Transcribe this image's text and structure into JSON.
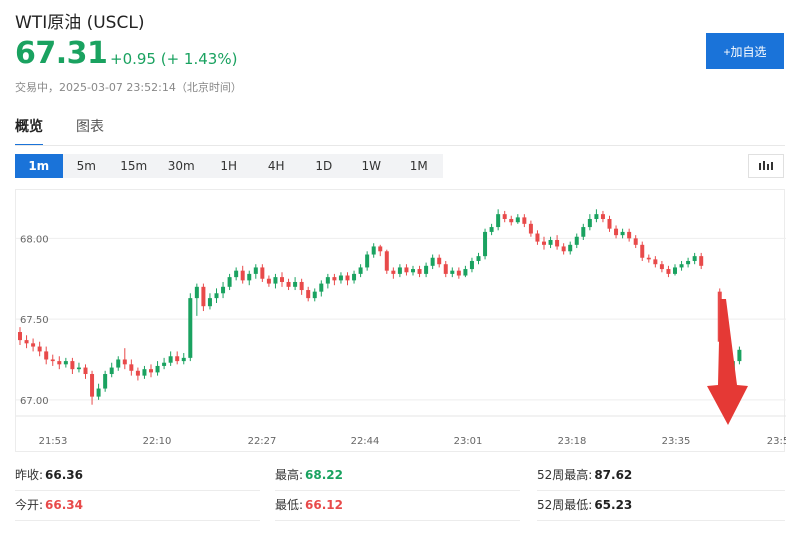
{
  "header": {
    "title": "WTI原油 (USCL)",
    "price": "67.31",
    "change": "+0.95 (+ 1.43%)",
    "status": "交易中，2025-03-07 23:52:14（北京时间）",
    "add_label": "+加自选"
  },
  "tabs": [
    {
      "label": "概览",
      "active": true
    },
    {
      "label": "图表",
      "active": false
    }
  ],
  "periods": [
    {
      "label": "1m",
      "active": true
    },
    {
      "label": "5m"
    },
    {
      "label": "15m"
    },
    {
      "label": "30m"
    },
    {
      "label": "1H"
    },
    {
      "label": "4H"
    },
    {
      "label": "1D"
    },
    {
      "label": "1W"
    },
    {
      "label": "1M"
    }
  ],
  "stats": {
    "prev_close_label": "昨收:",
    "prev_close": "66.36",
    "high_label": "最高:",
    "high": "68.22",
    "w52_high_label": "52周最高:",
    "w52_high": "87.62",
    "open_label": "今开:",
    "open": "66.34",
    "low_label": "最低:",
    "low": "66.12",
    "w52_low_label": "52周最低:",
    "w52_low": "65.23"
  },
  "colors": {
    "up": "#1aa260",
    "down": "#e84a4a",
    "accent": "#1a73d9",
    "annotation_arrow": "#e53935"
  },
  "chart_data": {
    "type": "candlestick",
    "x_ticks": [
      "21:53",
      "22:10",
      "22:27",
      "22:44",
      "23:01",
      "23:18",
      "23:35",
      "23:5"
    ],
    "y_ticks": [
      "68.00",
      "67.50",
      "67.00"
    ],
    "ylim": [
      66.9,
      68.25
    ],
    "grid": "horizontal",
    "annotation": "red-down-arrow",
    "candles": [
      [
        67.42,
        67.37,
        67.45,
        67.34
      ],
      [
        67.37,
        67.35,
        67.4,
        67.32
      ],
      [
        67.35,
        67.33,
        67.38,
        67.3
      ],
      [
        67.33,
        67.3,
        67.36,
        67.27
      ],
      [
        67.3,
        67.25,
        67.33,
        67.22
      ],
      [
        67.25,
        67.24,
        67.28,
        67.21
      ],
      [
        67.24,
        67.22,
        67.27,
        67.19
      ],
      [
        67.22,
        67.24,
        67.26,
        67.2
      ],
      [
        67.24,
        67.19,
        67.26,
        67.16
      ],
      [
        67.19,
        67.2,
        67.23,
        67.17
      ],
      [
        67.2,
        67.16,
        67.22,
        67.13
      ],
      [
        67.16,
        67.02,
        67.18,
        66.97
      ],
      [
        67.02,
        67.07,
        67.1,
        67.0
      ],
      [
        67.07,
        67.16,
        67.18,
        67.05
      ],
      [
        67.16,
        67.2,
        67.23,
        67.14
      ],
      [
        67.2,
        67.25,
        67.27,
        67.18
      ],
      [
        67.25,
        67.22,
        67.32,
        67.19
      ],
      [
        67.22,
        67.18,
        67.25,
        67.15
      ],
      [
        67.18,
        67.15,
        67.2,
        67.12
      ],
      [
        67.15,
        67.19,
        67.21,
        67.13
      ],
      [
        67.19,
        67.17,
        67.22,
        67.14
      ],
      [
        67.17,
        67.21,
        67.24,
        67.15
      ],
      [
        67.21,
        67.23,
        67.26,
        67.19
      ],
      [
        67.23,
        67.27,
        67.3,
        67.21
      ],
      [
        67.27,
        67.24,
        67.3,
        67.22
      ],
      [
        67.24,
        67.26,
        67.29,
        67.22
      ],
      [
        67.26,
        67.63,
        67.66,
        67.24
      ],
      [
        67.63,
        67.7,
        67.72,
        67.52
      ],
      [
        67.7,
        67.58,
        67.72,
        67.55
      ],
      [
        67.58,
        67.63,
        67.66,
        67.56
      ],
      [
        67.63,
        67.66,
        67.69,
        67.6
      ],
      [
        67.66,
        67.7,
        67.73,
        67.63
      ],
      [
        67.7,
        67.76,
        67.78,
        67.68
      ],
      [
        67.76,
        67.8,
        67.82,
        67.74
      ],
      [
        67.8,
        67.74,
        67.83,
        67.72
      ],
      [
        67.74,
        67.78,
        67.8,
        67.71
      ],
      [
        67.78,
        67.82,
        67.84,
        67.75
      ],
      [
        67.82,
        67.75,
        67.84,
        67.73
      ],
      [
        67.75,
        67.72,
        67.77,
        67.7
      ],
      [
        67.72,
        67.76,
        67.78,
        67.69
      ],
      [
        67.76,
        67.73,
        67.79,
        67.7
      ],
      [
        67.73,
        67.7,
        67.75,
        67.68
      ],
      [
        67.7,
        67.73,
        67.76,
        67.68
      ],
      [
        67.73,
        67.68,
        67.75,
        67.65
      ],
      [
        67.68,
        67.63,
        67.7,
        67.61
      ],
      [
        67.63,
        67.67,
        67.69,
        67.61
      ],
      [
        67.67,
        67.72,
        67.74,
        67.64
      ],
      [
        67.72,
        67.76,
        67.78,
        67.69
      ],
      [
        67.76,
        67.74,
        67.78,
        67.71
      ],
      [
        67.74,
        67.77,
        67.79,
        67.72
      ],
      [
        67.77,
        67.74,
        67.79,
        67.71
      ],
      [
        67.74,
        67.78,
        67.8,
        67.72
      ],
      [
        67.78,
        67.82,
        67.84,
        67.76
      ],
      [
        67.82,
        67.9,
        67.92,
        67.8
      ],
      [
        67.9,
        67.95,
        67.97,
        67.88
      ],
      [
        67.95,
        67.92,
        67.96,
        67.89
      ],
      [
        67.92,
        67.8,
        67.93,
        67.78
      ],
      [
        67.8,
        67.78,
        67.82,
        67.75
      ],
      [
        67.78,
        67.82,
        67.84,
        67.76
      ],
      [
        67.82,
        67.79,
        67.84,
        67.77
      ],
      [
        67.79,
        67.81,
        67.83,
        67.77
      ],
      [
        67.81,
        67.78,
        67.83,
        67.76
      ],
      [
        67.78,
        67.83,
        67.85,
        67.76
      ],
      [
        67.83,
        67.88,
        67.9,
        67.81
      ],
      [
        67.88,
        67.84,
        67.9,
        67.82
      ],
      [
        67.84,
        67.78,
        67.86,
        67.76
      ],
      [
        67.78,
        67.8,
        67.82,
        67.76
      ],
      [
        67.8,
        67.77,
        67.82,
        67.75
      ],
      [
        67.77,
        67.81,
        67.83,
        67.76
      ],
      [
        67.81,
        67.86,
        67.88,
        67.79
      ],
      [
        67.86,
        67.89,
        67.91,
        67.84
      ],
      [
        67.89,
        68.04,
        68.06,
        67.87
      ],
      [
        68.04,
        68.07,
        68.09,
        68.02
      ],
      [
        68.07,
        68.15,
        68.18,
        68.05
      ],
      [
        68.15,
        68.12,
        68.17,
        68.1
      ],
      [
        68.12,
        68.1,
        68.14,
        68.08
      ],
      [
        68.1,
        68.13,
        68.15,
        68.09
      ],
      [
        68.13,
        68.09,
        68.15,
        68.07
      ],
      [
        68.09,
        68.03,
        68.11,
        68.01
      ],
      [
        68.03,
        67.98,
        68.05,
        67.96
      ],
      [
        67.98,
        67.96,
        68.01,
        67.93
      ],
      [
        67.96,
        67.99,
        68.01,
        67.94
      ],
      [
        67.99,
        67.95,
        68.02,
        67.93
      ],
      [
        67.95,
        67.92,
        67.97,
        67.9
      ],
      [
        67.92,
        67.96,
        67.98,
        67.9
      ],
      [
        67.96,
        68.01,
        68.03,
        67.94
      ],
      [
        68.01,
        68.07,
        68.09,
        67.99
      ],
      [
        68.07,
        68.12,
        68.15,
        68.05
      ],
      [
        68.12,
        68.15,
        68.18,
        68.1
      ],
      [
        68.15,
        68.12,
        68.17,
        68.1
      ],
      [
        68.12,
        68.06,
        68.14,
        68.04
      ],
      [
        68.06,
        68.02,
        68.08,
        68.0
      ],
      [
        68.02,
        68.04,
        68.06,
        68.0
      ],
      [
        68.04,
        68.0,
        68.06,
        67.98
      ],
      [
        68.0,
        67.96,
        68.02,
        67.94
      ],
      [
        67.96,
        67.88,
        67.98,
        67.86
      ],
      [
        67.88,
        67.87,
        67.9,
        67.85
      ],
      [
        67.87,
        67.84,
        67.89,
        67.82
      ],
      [
        67.84,
        67.81,
        67.86,
        67.79
      ],
      [
        67.81,
        67.78,
        67.83,
        67.76
      ],
      [
        67.78,
        67.82,
        67.84,
        67.77
      ],
      [
        67.82,
        67.84,
        67.86,
        67.8
      ],
      [
        67.84,
        67.86,
        67.88,
        67.82
      ],
      [
        67.86,
        67.89,
        67.91,
        67.84
      ],
      [
        67.89,
        67.83,
        67.91,
        67.81
      ],
      [
        67.67,
        67.36,
        67.69,
        67.33
      ],
      [
        67.36,
        67.08,
        67.38,
        66.92
      ],
      [
        67.08,
        67.24,
        67.26,
        67.06
      ],
      [
        67.24,
        67.31,
        67.33,
        67.22
      ]
    ]
  }
}
